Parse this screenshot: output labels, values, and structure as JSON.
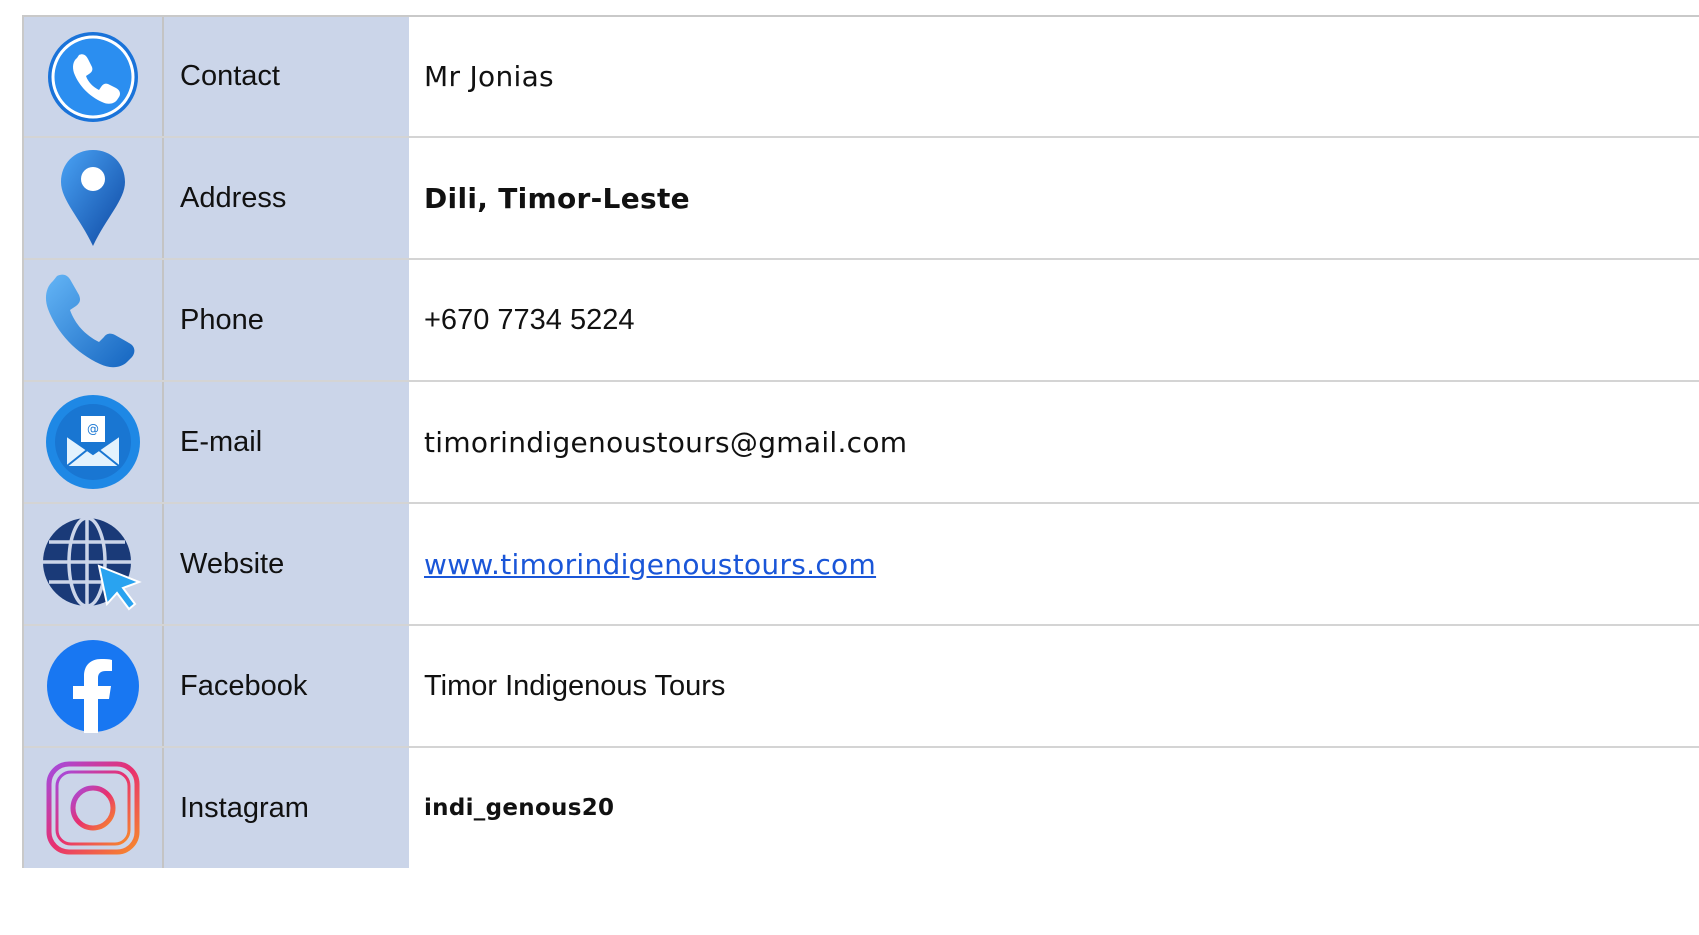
{
  "rows": [
    {
      "key": "contact",
      "icon": "phone-circle-icon",
      "label": "Contact",
      "value": "Mr Jonias"
    },
    {
      "key": "address",
      "icon": "map-pin-icon",
      "label": "Address",
      "value": "Dili, Timor-Leste"
    },
    {
      "key": "phone",
      "icon": "phone-handset-icon",
      "label": "Phone",
      "value": "+670 7734 5224"
    },
    {
      "key": "email",
      "icon": "envelope-icon",
      "label": "E-mail",
      "value": "timorindigenoustours@gmail.com"
    },
    {
      "key": "website",
      "icon": "globe-cursor-icon",
      "label": "Website",
      "value": "www.timorindigenoustours.com"
    },
    {
      "key": "facebook",
      "icon": "facebook-icon",
      "label": "Facebook",
      "value": "Timor Indigenous Tours"
    },
    {
      "key": "instagram",
      "icon": "instagram-icon",
      "label": "Instagram",
      "value": "indi_genous20"
    }
  ],
  "colors": {
    "label_bg": "#cbd5e9",
    "link": "#1a56d8",
    "icon_blue": "#1e88e5",
    "facebook_blue": "#1877f2"
  }
}
